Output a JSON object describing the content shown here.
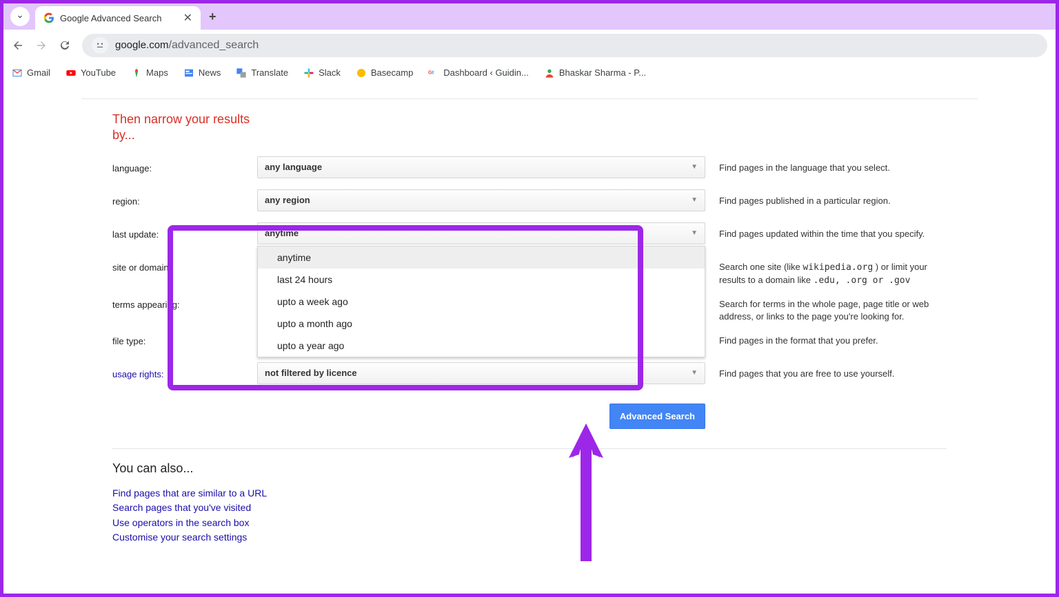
{
  "browser": {
    "tab_title": "Google Advanced Search",
    "url_host": "google.com",
    "url_path": "/advanced_search"
  },
  "bookmarks": [
    {
      "label": "Gmail"
    },
    {
      "label": "YouTube"
    },
    {
      "label": "Maps"
    },
    {
      "label": "News"
    },
    {
      "label": "Translate"
    },
    {
      "label": "Slack"
    },
    {
      "label": "Basecamp"
    },
    {
      "label": "Dashboard ‹ Guidin..."
    },
    {
      "label": "Bhaskar Sharma - P..."
    }
  ],
  "page": {
    "narrow_title": "Then narrow your results by...",
    "rows": {
      "language": {
        "label": "language:",
        "value": "any language",
        "help": "Find pages in the language that you select."
      },
      "region": {
        "label": "region:",
        "value": "any region",
        "help": "Find pages published in a particular region."
      },
      "last_update": {
        "label": "last update:",
        "value": "anytime",
        "help": "Find pages updated within the time that you specify.",
        "options": [
          "anytime",
          "last 24 hours",
          "upto a week ago",
          "upto a month ago",
          "upto a year ago"
        ]
      },
      "site": {
        "label": "site or domain:",
        "help_pre": "Search one site (like ",
        "help_code1": "wikipedia.org",
        "help_mid": " ) or limit your results to a domain like ",
        "help_code2": ".edu, .org or .gov"
      },
      "terms": {
        "label": "terms appearing:",
        "help": "Search for terms in the whole page, page title or web address, or links to the page you're looking for."
      },
      "filetype": {
        "label": "file type:",
        "help": "Find pages in the format that you prefer."
      },
      "usage": {
        "label": "usage rights:",
        "value": "not filtered by licence",
        "help": "Find pages that you are free to use yourself."
      }
    },
    "submit_label": "Advanced Search",
    "also_title": "You can also...",
    "also_links": [
      "Find pages that are similar to a URL",
      "Search pages that you've visited",
      "Use operators in the search box",
      "Customise your search settings"
    ]
  }
}
